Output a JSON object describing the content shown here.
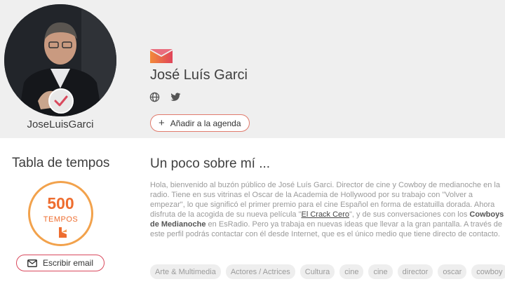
{
  "profile": {
    "username": "JoseLuisGarci",
    "display_name": "José Luís Garci",
    "social_icons": [
      "globe-icon",
      "twitter-icon"
    ],
    "agenda_button": "Añadir a la agenda",
    "verified_icon": "checkmark-badge-icon"
  },
  "tempos": {
    "title": "Tabla de tempos",
    "count": "500",
    "label": "TEMPOS",
    "email_button": "Escribir email"
  },
  "about": {
    "title": "Un poco sobre mí ...",
    "text_1": "Hola, bienvenido al buzón público de José Luís Garci. Director de cine y Cowboy de medianoche en la radio. Tiene en sus vitrinas el Oscar de la Academia de Hollywood por su trabajo con \"Volver a empezar\", lo que significó el primer premio para el cine Español en forma de estatuilla dorada. Ahora disfruta de la acogida de su nueva película \"",
    "link": "El Crack Cero",
    "text_2": "\", y de sus conversaciones con los ",
    "bold": "Cowboys de Medianoche",
    "text_3": " en EsRadio. Pero ya trabaja en nuevas ideas que llevar a la gran pantalla. A través de este perfil podrás contactar con él desde Internet, que es el único medio que tiene directo de contacto."
  },
  "tags": [
    "Arte & Multimedia",
    "Actores / Actrices",
    "Cultura",
    "cine",
    "cine",
    "director",
    "oscar",
    "cowboy"
  ],
  "colors": {
    "accent_orange": "#ee6d2f",
    "accent_pink": "#d9495d",
    "hero_bg": "#efefef"
  }
}
